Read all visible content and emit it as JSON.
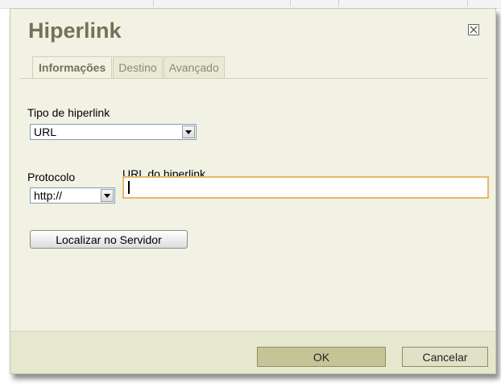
{
  "dialog": {
    "title": "Hiperlink",
    "close_icon": "close-icon"
  },
  "tabs": [
    {
      "label": "Informações",
      "active": true
    },
    {
      "label": "Destino",
      "active": false
    },
    {
      "label": "Avançado",
      "active": false
    }
  ],
  "link_type": {
    "label": "Tipo de hiperlink",
    "selected": "URL"
  },
  "protocol": {
    "label": "Protocolo",
    "selected": "http://"
  },
  "url": {
    "label": "URL do hiperlink",
    "value": ""
  },
  "buttons": {
    "browse": "Localizar no Servidor",
    "ok": "OK",
    "cancel": "Cancelar"
  },
  "colors": {
    "dialog_bg": "#f1f2e4",
    "title": "#737357",
    "focus_border": "#e8b869",
    "ok_bg": "#c4c496"
  }
}
